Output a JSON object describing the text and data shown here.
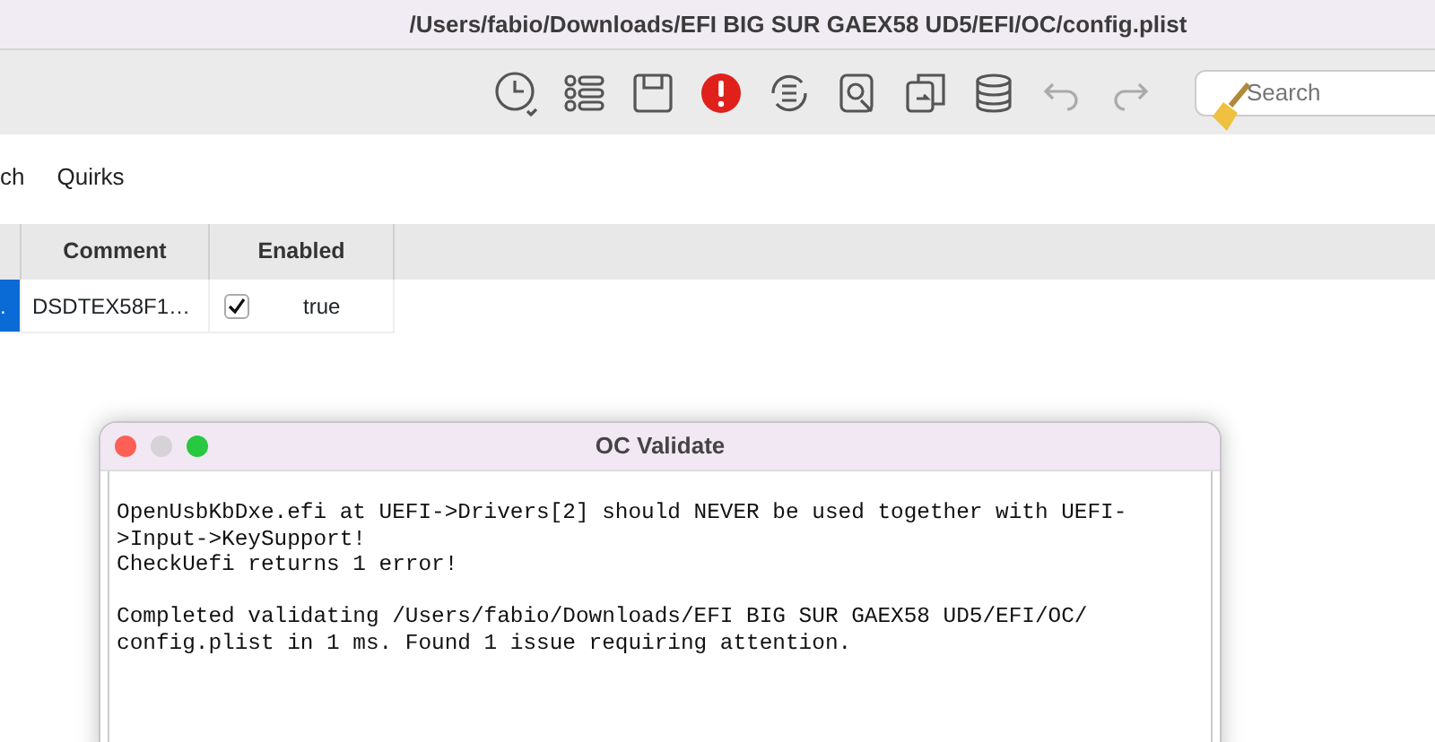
{
  "window": {
    "title": "/Users/fabio/Downloads/EFI BIG SUR GAEX58 UD5/EFI/OC/config.plist"
  },
  "toolbar": {
    "search": {
      "placeholder": "Search"
    }
  },
  "tabs": [
    {
      "label": "ch",
      "selected": false
    },
    {
      "label": "Quirks",
      "selected": false
    }
  ],
  "table": {
    "columns": [
      {
        "label": "Comment"
      },
      {
        "label": "Enabled"
      }
    ],
    "rows": [
      {
        "selected": true,
        "column_1": ".",
        "comment": "DSDTEX58F1…",
        "enabled": true,
        "enabled_text": "true"
      }
    ]
  },
  "dialog": {
    "title": "OC Validate",
    "paragraphs": [
      [
        "OpenUsbKbDxe.efi at UEFI->Drivers[2] should NEVER be used together with UEFI-",
        ">Input->KeySupport!",
        "CheckUefi returns 1 error!"
      ],
      [
        "Completed validating /Users/fabio/Downloads/EFI BIG SUR GAEX58 UD5/EFI/OC/",
        "config.plist in 1 ms. Found 1 issue requiring attention."
      ]
    ]
  }
}
